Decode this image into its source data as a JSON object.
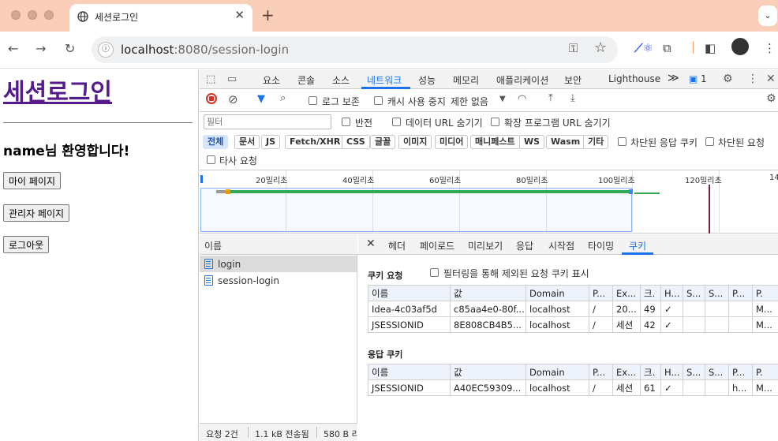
{
  "tab": {
    "title": "세션로그인",
    "close": "✕",
    "new": "+",
    "menu": "⌄"
  },
  "address": {
    "host": "localhost",
    "path": ":8080/session-login"
  },
  "page": {
    "heading": "세션로그인",
    "welcome": "name님 환영합니다!",
    "buttons": [
      "마이 페이지",
      "관리자 페이지",
      "로그아웃"
    ]
  },
  "devtools": {
    "tabs": [
      "요소",
      "콘솔",
      "소스",
      "네트워크",
      "성능",
      "메모리",
      "애플리케이션",
      "보안",
      "Lighthouse"
    ],
    "more": "≫",
    "issues_count": "1",
    "netbar": {
      "preserve_log": "로그 보존",
      "disable_cache": "캐시 사용 중지",
      "throttle": "제한 없음"
    },
    "filter": {
      "placeholder": "필터",
      "invert": "반전",
      "hide_data_urls": "데이터 URL 숨기기",
      "hide_ext_urls": "확장 프로그램 URL 숨기기"
    },
    "types": [
      "전체",
      "문서",
      "JS",
      "Fetch/XHR",
      "CSS",
      "글꼴",
      "이미지",
      "미디어",
      "매니페스트",
      "WS",
      "Wasm",
      "기타"
    ],
    "blocked_cookies": "차단된 응답 쿠키",
    "blocked_requests": "차단된 요청",
    "third_party": "타사 요청",
    "timeline_ticks": [
      "20밀리초",
      "40밀리초",
      "60밀리초",
      "80밀리초",
      "100밀리초",
      "120밀리초",
      "14"
    ],
    "name_header": "이름",
    "requests": [
      "login",
      "session-login"
    ],
    "status": {
      "requests": "요청 2건",
      "transferred": "1.1 kB 전송됨",
      "resources": "580 B 리"
    },
    "detail_tabs": [
      "헤더",
      "페이로드",
      "미리보기",
      "응답",
      "시작점",
      "타이밍",
      "쿠키"
    ],
    "cookies": {
      "request_title": "쿠키 요청",
      "show_filtered": "필터링을 통해 제외된 요청 쿠키 표시",
      "response_title": "응답 쿠키",
      "columns": [
        "이름",
        "값",
        "Domain",
        "P...",
        "Ex...",
        "크.",
        "H...",
        "S...",
        "S...",
        "P...",
        "P."
      ],
      "request_rows": [
        [
          "Idea-4c03af5d",
          "c85aa4e0-80f...",
          "localhost",
          "/",
          "20...",
          "49",
          "✓",
          "",
          "",
          "",
          "M..."
        ],
        [
          "JSESSIONID",
          "8E808CB4B5...",
          "localhost",
          "/",
          "세션",
          "42",
          "✓",
          "",
          "",
          "",
          "M..."
        ]
      ],
      "response_rows": [
        [
          "JSESSIONID",
          "A40EC59309...",
          "localhost",
          "/",
          "세션",
          "61",
          "✓",
          "",
          "",
          "h...",
          "M..."
        ]
      ]
    }
  }
}
